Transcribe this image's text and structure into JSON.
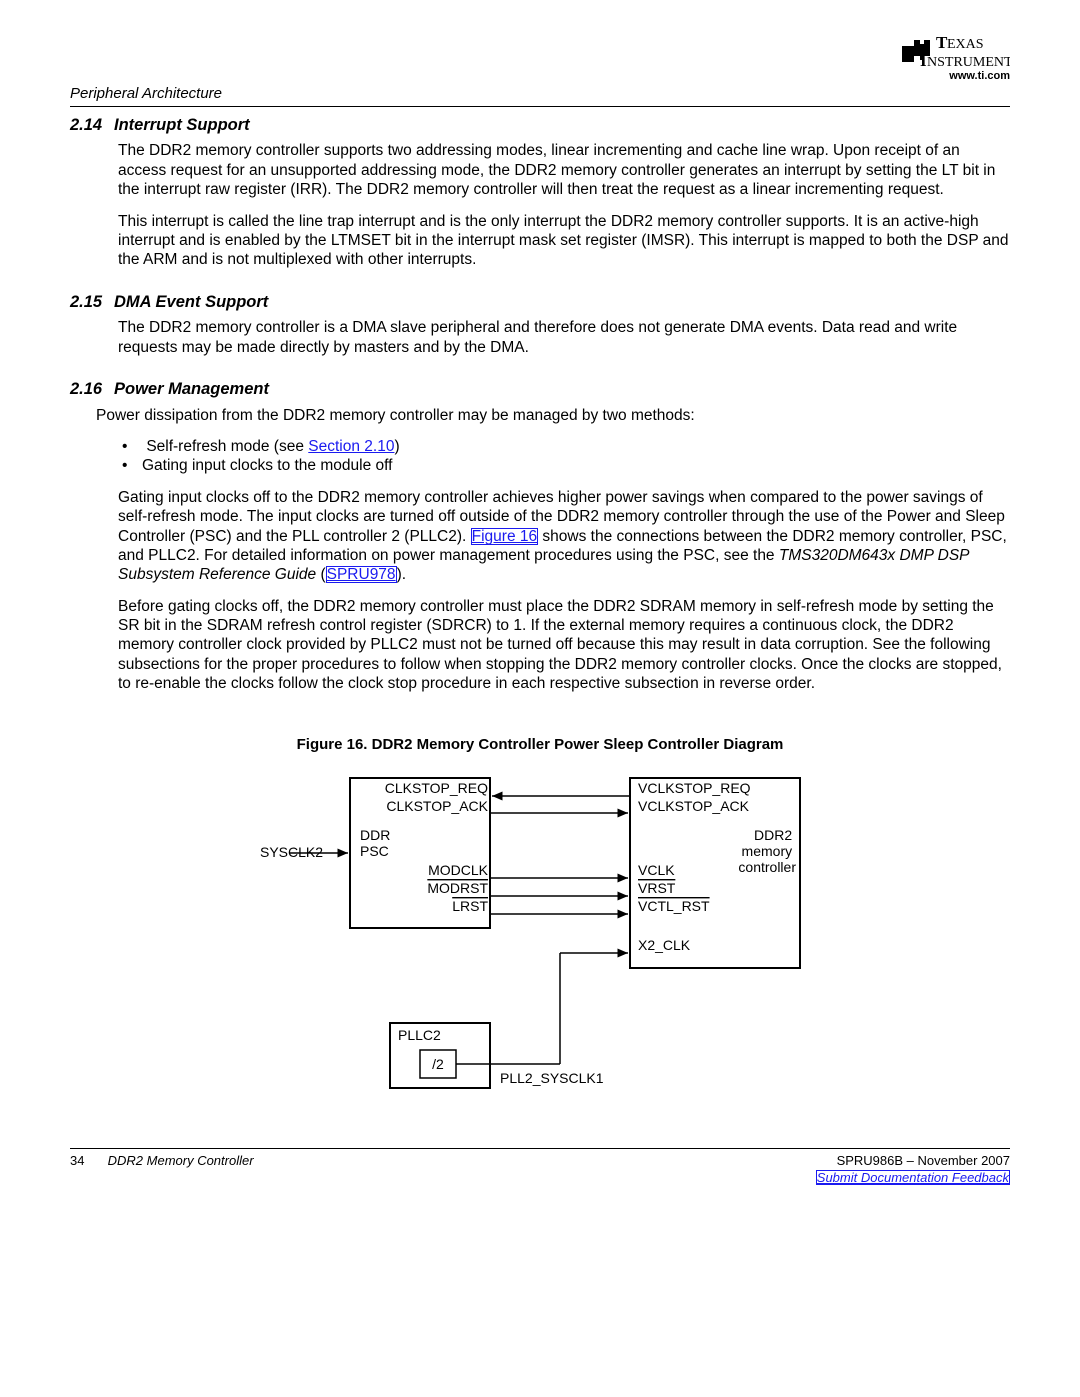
{
  "header": {
    "section_label": "Peripheral Architecture",
    "logo_url": "www.ti.com"
  },
  "sections": {
    "s214": {
      "num": "2.14",
      "title": "Interrupt Support",
      "p1": "The DDR2 memory controller supports two addressing modes, linear incrementing and cache line wrap. Upon receipt of an access request for an unsupported addressing mode, the DDR2 memory controller generates an interrupt by setting the LT bit in the interrupt raw register (IRR). The DDR2 memory controller will then treat the request as a linear incrementing request.",
      "p2": "This interrupt is called the line trap interrupt and is the only interrupt the DDR2 memory controller supports. It is an active-high interrupt and is enabled by the LTMSET bit in the interrupt mask set register (IMSR). This interrupt is mapped to both the DSP and the ARM and is not multiplexed with other interrupts."
    },
    "s215": {
      "num": "2.15",
      "title": "DMA Event Support",
      "p1": "The DDR2 memory controller is a DMA slave peripheral and therefore does not generate DMA events. Data read and write requests may be made directly by masters and by the DMA."
    },
    "s216": {
      "num": "2.16",
      "title": "Power Management",
      "p1": "Power dissipation from the DDR2 memory controller may be managed by two methods:",
      "b1_pre": "Self-refresh mode (see ",
      "b1_link": "Section 2.10",
      "b1_post": ")",
      "b2": "Gating input clocks to the module off",
      "p2_pre": "Gating input clocks off to the DDR2 memory controller achieves higher power savings when compared to the power savings of self-refresh mode. The input clocks are turned off outside of the DDR2 memory controller through the use of the Power and Sleep Controller (PSC) and the PLL controller 2 (PLLC2). ",
      "p2_link1": "Figure 16",
      "p2_mid": " shows the connections between the DDR2 memory controller, PSC, and PLLC2. For detailed information on power management procedures using the PSC, see the ",
      "p2_italic": "TMS320DM643x DMP DSP Subsystem Reference Guide",
      "p2_paren_open": " (",
      "p2_link2": "SPRU978",
      "p2_paren_close": ").",
      "p3": "Before gating clocks off, the DDR2 memory controller must place the DDR2 SDRAM memory in self-refresh mode by setting the SR bit in the SDRAM refresh control register (SDRCR) to 1. If the external memory requires a continuous clock, the DDR2 memory controller clock provided by PLLC2 must not be turned off because this may result in data corruption. See the following subsections for the proper procedures to follow when stopping the DDR2 memory controller clocks. Once the clocks are stopped, to re-enable the clocks follow the clock stop procedure in each respective subsection in reverse order."
    }
  },
  "figure": {
    "caption": "Figure 16. DDR2 Memory Controller Power Sleep Controller Diagram",
    "labels": {
      "sysclk2": "SYSCLK2",
      "ddr_psc": "DDR\nPSC",
      "clkstop_req": "CLKSTOP_REQ",
      "clkstop_ack": "CLKSTOP_ACK",
      "modclk": "MODCLK",
      "modrst": "MODRST",
      "lrst": "LRST",
      "vclkstop_req": "VCLKSTOP_REQ",
      "vclkstop_ack": "VCLKSTOP_ACK",
      "vclk": "VCLK",
      "vrst": "VRST",
      "vctl_rst": "VCTL_RST",
      "x2_clk": "X2_CLK",
      "ddr2_mem": "DDR2\nmemory\ncontroller",
      "pllc2": "PLLC2",
      "div2": "/2",
      "pll2_sysclk1": "PLL2_SYSCLK1"
    }
  },
  "footer": {
    "page_num": "34",
    "doc_title": "DDR2 Memory Controller",
    "doc_id": "SPRU986B – November 2007",
    "feedback": "Submit Documentation Feedback"
  }
}
